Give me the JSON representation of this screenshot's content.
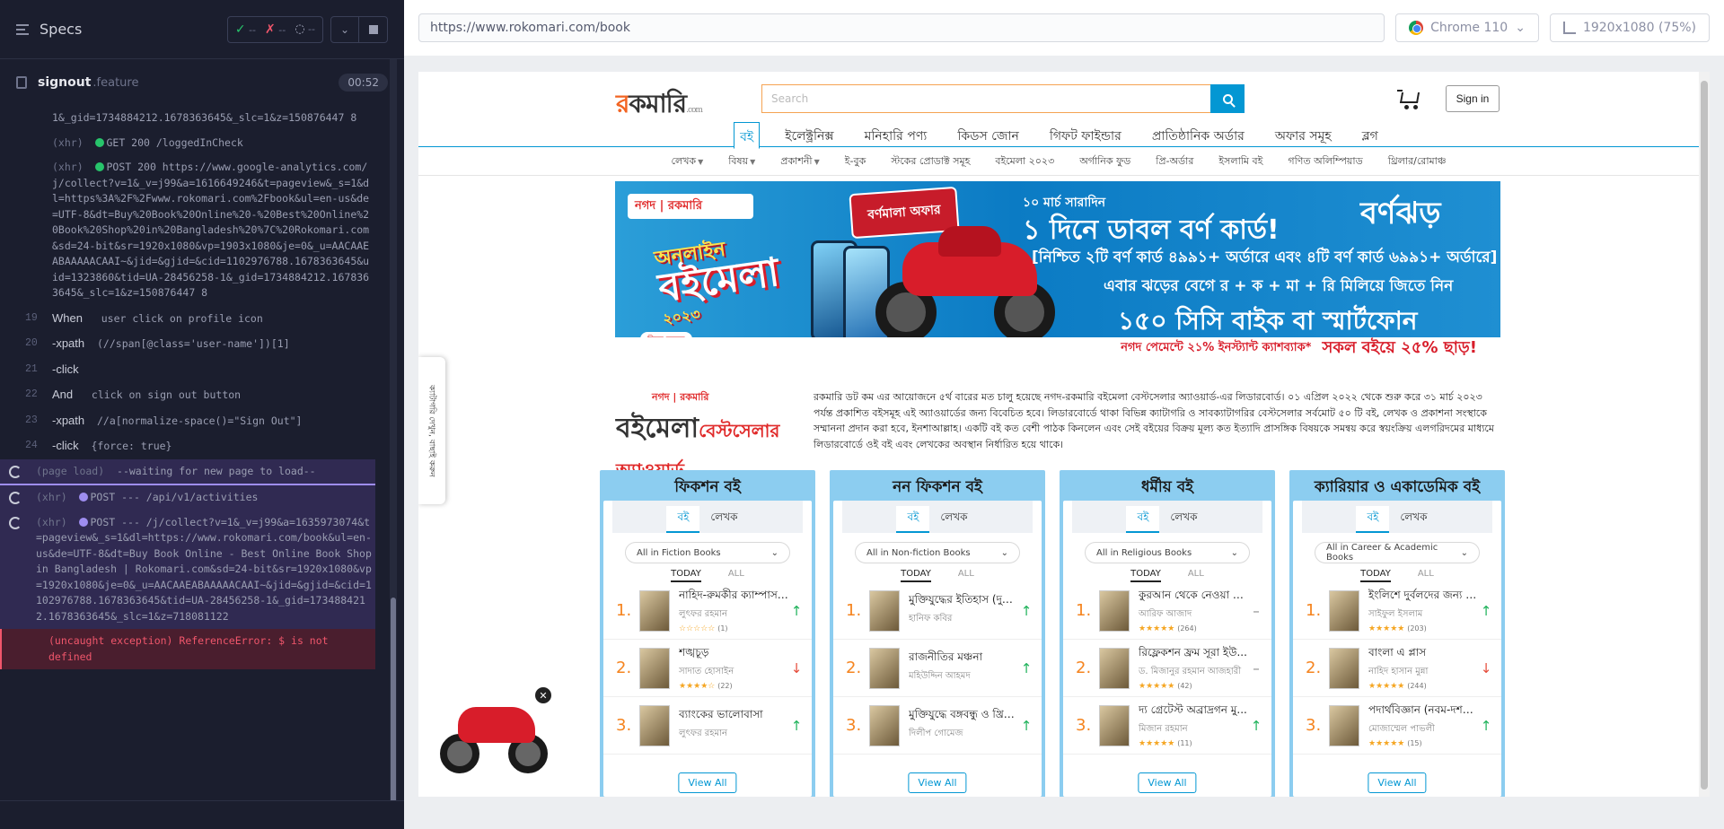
{
  "runner": {
    "header_title": "Specs",
    "stats": {
      "pass": "--",
      "fail": "--",
      "pending": "--"
    },
    "spec_name": "signout",
    "spec_ext": ".feature",
    "duration": "00:52",
    "log": [
      {
        "num": "",
        "kind": "cont",
        "text": "1&_gid=1734884212.1678363645&_slc=1&z=150876447 8"
      },
      {
        "num": "",
        "kind": "xhr",
        "dot": "green",
        "tag": "(xhr)",
        "text": "GET 200 /loggedInCheck"
      },
      {
        "num": "",
        "kind": "xhr",
        "dot": "green",
        "tag": "(xhr)",
        "text": "POST 200 https://www.google-analytics.com/j/collect?v=1&_v=j99&a=1616649246&t=pageview&_s=1&dl=https%3A%2F%2Fwww.rokomari.com%2Fbook&ul=en-us&de=UTF-8&dt=Buy%20Book%20Online%20-%20Best%20Online%20Book%20Shop%20in%20Bangladesh%20%7C%20Rokomari.com&sd=24-bit&sr=1920x1080&vp=1903x1080&je=0&_u=AACAAEABAAAAACAAI~&jid=&gjid=&cid=1102976788.1678363645&uid=1323860&tid=UA-28456258-1&_gid=1734884212.1678363645&_slc=1&z=150876447 8"
      },
      {
        "num": "19",
        "kind": "step",
        "cmd": "When",
        "text": "user click on profile icon"
      },
      {
        "num": "20",
        "kind": "cmd",
        "cmd": "-xpath",
        "text": "(//span[@class='user-name'])[1]"
      },
      {
        "num": "21",
        "kind": "cmd",
        "cmd": "-click",
        "text": ""
      },
      {
        "num": "22",
        "kind": "step",
        "cmd": "And",
        "text": "click on sign out button"
      },
      {
        "num": "23",
        "kind": "cmd",
        "cmd": "-xpath",
        "text": "//a[normalize-space()=\"Sign Out\"]"
      },
      {
        "num": "24",
        "kind": "cmd",
        "cmd": "-click",
        "text": "{force: true}"
      }
    ],
    "pending": [
      {
        "tag": "(page load)",
        "text": "--waiting for new page to load--"
      },
      {
        "tag": "(xhr)",
        "text": "POST --- /api/v1/activities"
      },
      {
        "tag": "(xhr)",
        "text": "POST --- /j/collect?v=1&_v=j99&a=1635973074&t=pageview&_s=1&dl=https://www.rokomari.com/book&ul=en-us&de=UTF-8&dt=Buy Book Online - Best Online Book Shop in Bangladesh | Rokomari.com&sd=24-bit&sr=1920x1080&vp=1920x1080&je=0&_u=AACAAEABAAAAACAAI~&jid=&gjid=&cid=1102976788.1678363645&tid=UA-28456258-1&_gid=1734884212.1678363645&_slc=1&z=718081122"
      }
    ],
    "error": "(uncaught exception)  ReferenceError: $ is not defined"
  },
  "aut": {
    "url": "https://www.rokomari.com/book",
    "browser": "Chrome 110",
    "viewport": "1920x1080 (75%)"
  },
  "site": {
    "logo_r": "র",
    "logo_rest": "কমারি",
    "logo_com": ".com",
    "search_placeholder": "Search",
    "signin": "Sign in",
    "main_nav": [
      "বই",
      "ইলেক্ট্রনিক্স",
      "মনিহারি পণ্য",
      "কিডস জোন",
      "গিফট ফাইন্ডার",
      "প্রাতিষ্ঠানিক অর্ডার",
      "অফার সমূহ",
      "ব্লগ"
    ],
    "sub_nav": [
      "লেখক",
      "বিষয়",
      "প্রকাশনী",
      "ই-বুক",
      "স্টকের প্রোডাক্ট সমূহ",
      "বইমেলা ২০২৩",
      "অর্গানিক ফুড",
      "প্রি-অর্ডার",
      "ইসলামি বই",
      "গণিত অলিম্পিয়াড",
      "থ্রিলার/রোমাঞ্চ"
    ],
    "banner": {
      "nagad": "নগদ | রকমারি",
      "ob_small": "অনলাইন",
      "ob_big": "বইমেলা",
      "ob_year": "২০২৩",
      "click": "ক্লিক করুন",
      "offer_tag": "বর্ণমালা অফার",
      "date": "১০ মার্চ সারাদিন",
      "main": "১ দিনে ডাবল বর্ণ কার্ড!",
      "brand": "বর্ণঝড়",
      "sub": "[নিশ্চিত ২টি বর্ণ কার্ড ৪৯৯১+ অর্ডারে এবং ৪টি বর্ণ কার্ড ৬৯৯১+ অর্ডারে]",
      "sub2": "এবার ঝড়ের বেগে র + ক + মা + রি মিলিয়ে জিতে নিন",
      "big": "১৫০ সিসি বাইক বা স্মার্টফোন",
      "strip1": "নগদ পেমেন্টে ২১% ইনস্ট্যান্ট ক্যাশব্যাক*",
      "strip2": "সকল বইয়ে ২৫% ছাড়!"
    },
    "award": {
      "nagad": "নগদ | রকমারি",
      "title": "বইমেলা",
      "hl": "বেস্টসেলার অ্যাওয়ার্ড",
      "text": "রকমারি ডট কম এর আয়োজনে ৫র্থ বারের মত চালু হয়েছে নগদ-রকমারি বইমেলা বেস্টসেলার অ্যাওয়ার্ড-এর লিডারবোর্ড। ০১ এপ্রিল ২০২২ থেকে শুরু করে ৩১ মার্চ ২০২৩ পর্যন্ত প্রকাশিত বইসমূহ এই অ্যাওয়ার্ডের জন্য বিবেচিত হবে। লিডারবোর্ডে থাকা বিভিন্ন ক্যাটাগরি ও সাবক্যাটাগরির বেস্টসেলার সর্বমোট ৫০ টি বই, লেখক ও প্রকাশনা সংস্থাকে সম্মাননা প্রদান করা হবে, ইনশাআল্লাহ। একটি বই কত বেশী পাঠক কিনলেন এবং সেই বইয়ের বিক্রয় মূল্য কত ইত্যাদি প্রাসঙ্গিক বিষয়কে সমন্বয় করে স্বয়ংক্রিয় এলগরিদমের মাধ্যমে লিডারবোর্ডে ওই বই এবং লেখকের অবস্থান নির্ধারিত হয়ে থাকে।"
    },
    "side_tab": "ক্যাটাগরি দেখুন, বাছাই করুন",
    "columns": [
      {
        "title": "ফিকশন বই",
        "tab_on": "বই",
        "tab_off": "লেখক",
        "dropdown": "All in Fiction Books",
        "f_on": "TODAY",
        "f_off": "ALL",
        "view_all": "View All",
        "books": [
          {
            "rank": "1.",
            "title": "নাহিদ-রুমকীর ক্যাম্পাস ...",
            "author": "লুৎফর রহমান",
            "stars": "☆☆☆☆☆",
            "count": "(1)",
            "trend": "↑",
            "dir": "up"
          },
          {
            "rank": "2.",
            "title": "শঙ্খচূড়",
            "author": "সাদাত হোসাইন",
            "stars": "★★★★☆",
            "count": "(22)",
            "trend": "↓",
            "dir": "down"
          },
          {
            "rank": "3.",
            "title": "ব্যাংকের ভালোবাসা",
            "author": "লুৎফর রহমান",
            "stars": "",
            "count": "",
            "trend": "↑",
            "dir": "up"
          }
        ]
      },
      {
        "title": "নন ফিকশন বই",
        "tab_on": "বই",
        "tab_off": "লেখক",
        "dropdown": "All in Non-fiction Books",
        "f_on": "TODAY",
        "f_off": "ALL",
        "view_all": "View All",
        "books": [
          {
            "rank": "1.",
            "title": "মুক্তিযুদ্ধের ইতিহাস (দুই খণ্ড এ...",
            "author": "হানিফ কবির",
            "stars": "",
            "count": "",
            "trend": "↑",
            "dir": "up"
          },
          {
            "rank": "2.",
            "title": "রাজনীতির মঞ্চনা",
            "author": "মহিউদ্দিন আহমদ",
            "stars": "",
            "count": "",
            "trend": "↑",
            "dir": "up"
          },
          {
            "rank": "3.",
            "title": "মুক্তিযুদ্ধে বঙ্গবন্ধু ও খ্রিস্টা...",
            "author": "দিলীপ গোমেজ",
            "stars": "",
            "count": "",
            "trend": "↑",
            "dir": "up"
          }
        ]
      },
      {
        "title": "ধর্মীয় বই",
        "tab_on": "বই",
        "tab_off": "লেখক",
        "dropdown": "All in Religious Books",
        "f_on": "TODAY",
        "f_off": "ALL",
        "view_all": "View All",
        "books": [
          {
            "rank": "1.",
            "title": "কুরআন থেকে নেওয়া জী...",
            "author": "আরিফ আজাদ",
            "stars": "★★★★★",
            "count": "(264)",
            "trend": "–",
            "dir": "flat"
          },
          {
            "rank": "2.",
            "title": "রিফ্লেকশন ফ্রম সূরা ইউ...",
            "author": "ড. মিজানুর রহমান আজহারী",
            "stars": "★★★★★",
            "count": "(42)",
            "trend": "–",
            "dir": "flat"
          },
          {
            "rank": "3.",
            "title": "দ্য গ্রেটেস্ট অব্রাদ্রগন মু...",
            "author": "মিজান রহমান",
            "stars": "★★★★★",
            "count": "(11)",
            "trend": "↑",
            "dir": "up"
          }
        ]
      },
      {
        "title": "ক্যারিয়ার ও একাডেমিক বই",
        "tab_on": "বই",
        "tab_off": "লেখক",
        "dropdown": "All in Career & Academic Books",
        "f_on": "TODAY",
        "f_off": "ALL",
        "view_all": "View All",
        "books": [
          {
            "rank": "1.",
            "title": "ইংলিশে দুর্বলদের জন্য V...",
            "author": "সাইফুল ইসলাম",
            "stars": "★★★★★",
            "count": "(203)",
            "trend": "↑",
            "dir": "up"
          },
          {
            "rank": "2.",
            "title": "বাংলা এ প্লাস",
            "author": "নাহিদ হাসান মুন্না",
            "stars": "★★★★★",
            "count": "(244)",
            "trend": "↓",
            "dir": "down"
          },
          {
            "rank": "3.",
            "title": "পদার্থবিজ্ঞান (নবম-দশম ...",
            "author": "মোজাম্মেল পাভলী",
            "stars": "★★★★★",
            "count": "(15)",
            "trend": "↑",
            "dir": "up"
          }
        ]
      }
    ]
  }
}
